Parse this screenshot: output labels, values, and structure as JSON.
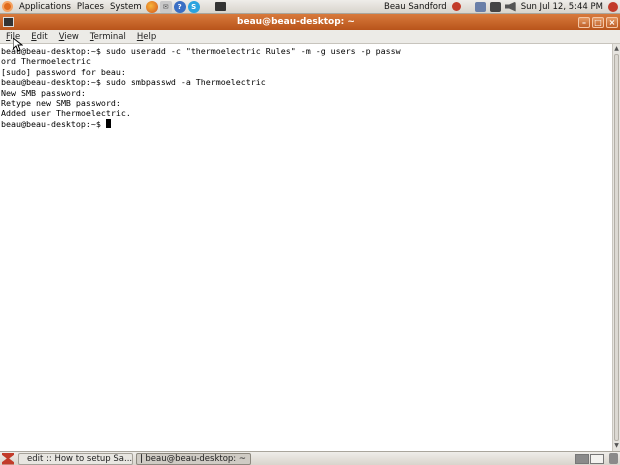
{
  "top_panel": {
    "menus": [
      "Applications",
      "Places",
      "System"
    ],
    "user": "Beau Sandford",
    "clock": "Sun Jul 12,  5:44 PM"
  },
  "window": {
    "title": "beau@beau-desktop: ~",
    "buttons": {
      "minimize": "–",
      "maximize": "□",
      "close": "×"
    }
  },
  "menubar": {
    "items": [
      {
        "mnemonic": "F",
        "rest": "ile"
      },
      {
        "mnemonic": "E",
        "rest": "dit"
      },
      {
        "mnemonic": "V",
        "rest": "iew"
      },
      {
        "mnemonic": "T",
        "rest": "erminal"
      },
      {
        "mnemonic": "H",
        "rest": "elp"
      }
    ]
  },
  "terminal": {
    "lines": [
      "beau@beau-desktop:~$ sudo useradd -c \"thermoelectric Rules\" -m -g users -p passw",
      "ord Thermoelectric",
      "[sudo] password for beau:",
      "beau@beau-desktop:~$ sudo smbpasswd -a Thermoelectric",
      "New SMB password:",
      "Retype new SMB password:",
      "Added user Thermoelectric.",
      "beau@beau-desktop:~$ "
    ]
  },
  "taskbar": {
    "tasks": [
      {
        "label": "edit :: How to setup Sa..."
      },
      {
        "label": "beau@beau-desktop: ~"
      }
    ]
  },
  "colors": {
    "titlebar": "#c8632a",
    "panel": "#e3e0da",
    "terminal_bg": "#ffffff"
  }
}
